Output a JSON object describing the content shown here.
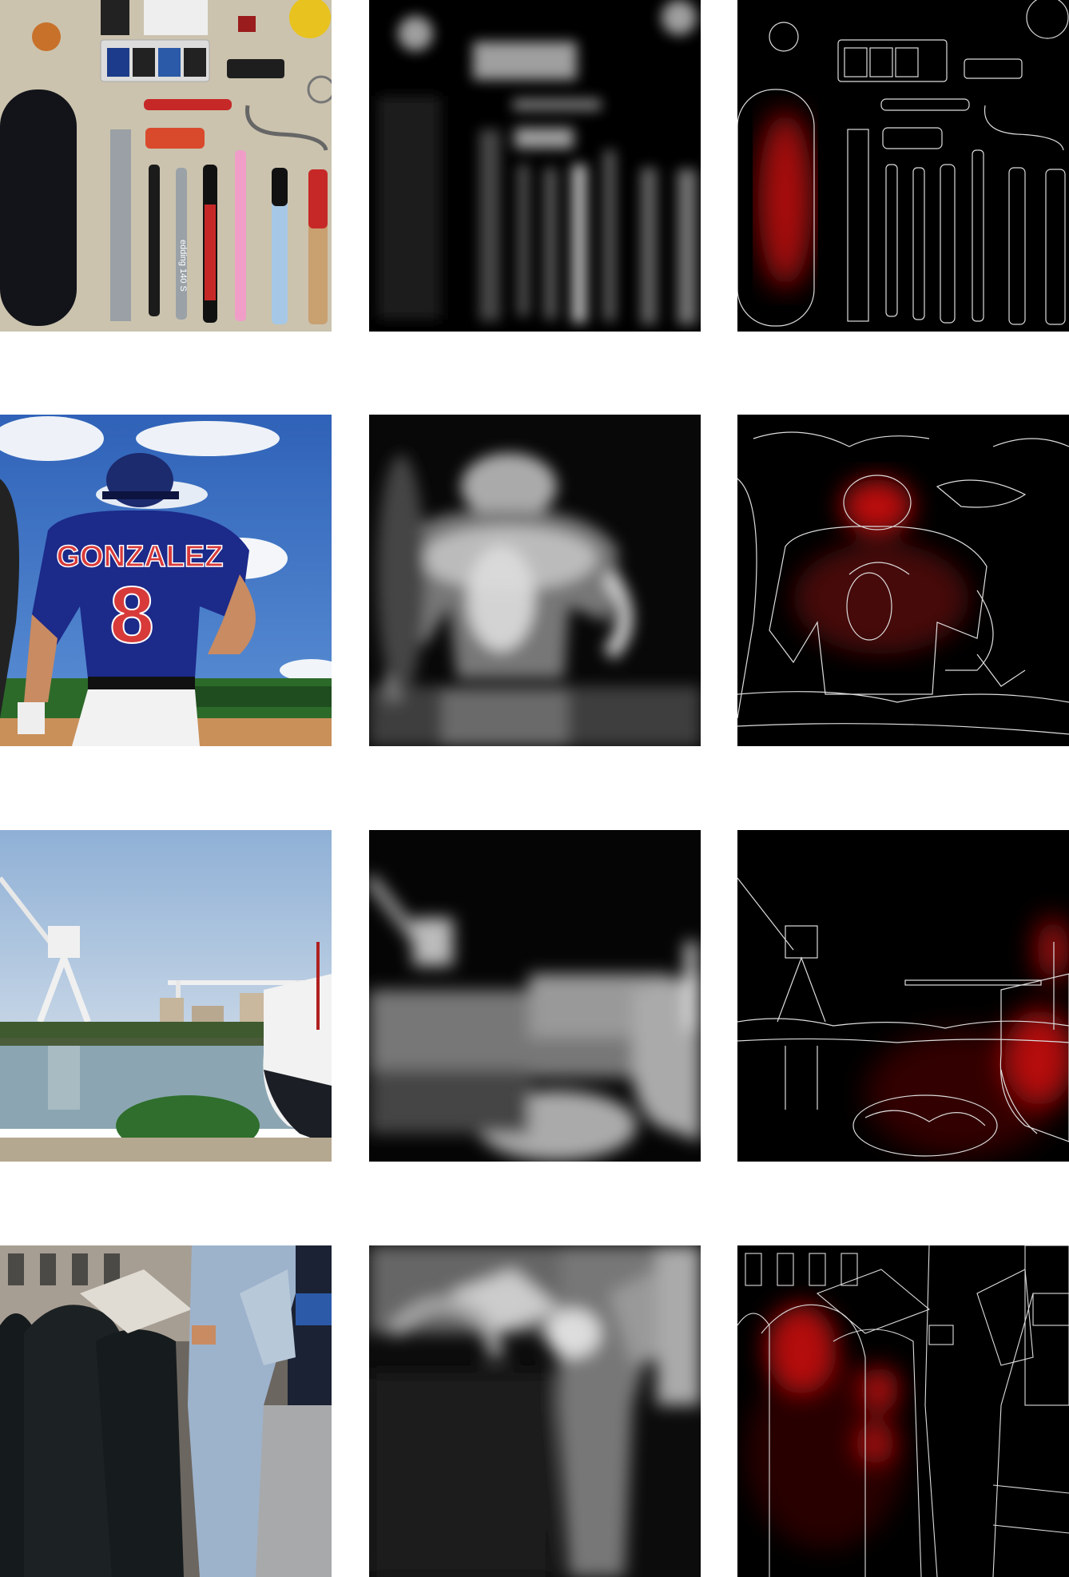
{
  "figure": {
    "layout": "4 rows x 3 columns image grid",
    "columns": [
      "original photo",
      "grayscale saliency map",
      "edge map with red heat overlay"
    ],
    "rows": [
      {
        "scene": "flat-lay of stationery items on beige surface",
        "visible_text": [
          "edding 140 S"
        ]
      },
      {
        "scene": "baseball player in blue jersey under blue sky",
        "visible_text": [
          "GONZALEZ",
          "8"
        ]
      },
      {
        "scene": "harbor with crane, bridge, boat and reflective water",
        "visible_text": []
      },
      {
        "scene": "man in light blue suit reading newspaper beside mailboxes",
        "visible_text": []
      }
    ]
  },
  "text": {
    "marker_label": "edding 140 S",
    "jersey_name": "GONZALEZ",
    "jersey_number": "8"
  },
  "colors": {
    "heat_red": "#d01010",
    "sky_blue": "#3a72c4",
    "jersey_blue": "#1c2a8a",
    "jersey_red": "#d83a3a",
    "beige": "#cfc6b1"
  }
}
